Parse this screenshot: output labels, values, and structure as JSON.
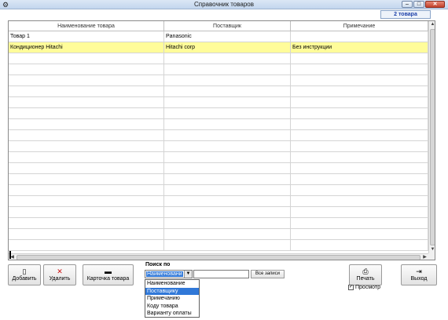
{
  "window": {
    "title": "Справочник товаров",
    "min_glyph": "–",
    "max_glyph": "□",
    "close_glyph": "✕",
    "app_icon": "gear-icon"
  },
  "count_badge": "2 товара",
  "table": {
    "columns": [
      "Наименование товара",
      "Поставщик",
      "Примечание"
    ],
    "rows": [
      [
        "Товар 1",
        "Panasonic",
        ""
      ],
      [
        "Кондиционер Hitachi",
        "Hitachi corp",
        "Без инструкции"
      ]
    ],
    "selected_row": 1,
    "selected_color": "#fffc9a"
  },
  "toolbar": {
    "add_label": "Добавить",
    "delete_label": "Удалить",
    "card_label": "Карточка товара",
    "print_label": "Печать",
    "exit_label": "Выход",
    "delete_icon_color": "#cc1111"
  },
  "search": {
    "label": "Поиск по",
    "selected": "Наименовани",
    "value": "",
    "all_records_label": "Все записи",
    "options": [
      "Наименование",
      "Поставщику",
      "Примечанию",
      "Коду товара",
      "Варианту оплаты"
    ],
    "highlighted_option": 1
  },
  "preview": {
    "label": "Просмотр",
    "checked": true
  }
}
